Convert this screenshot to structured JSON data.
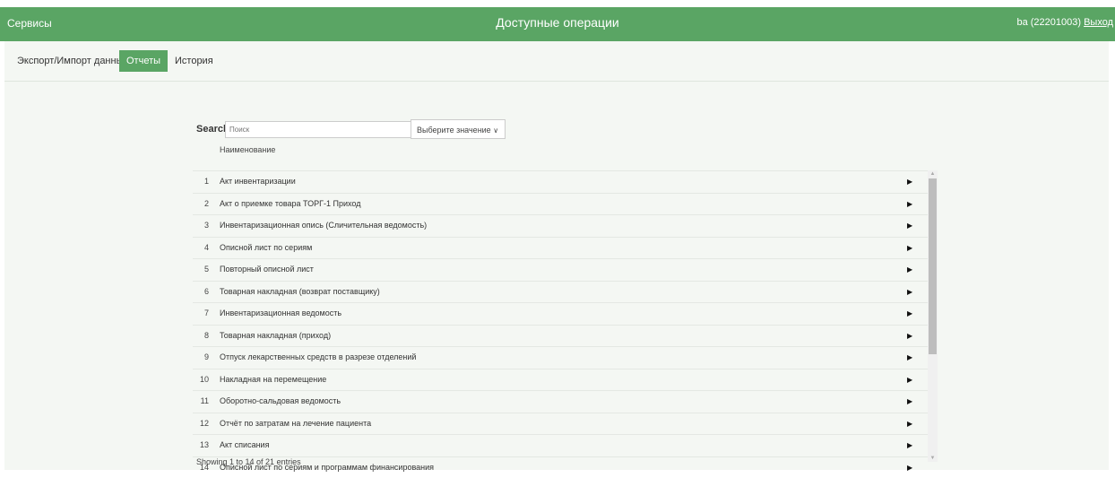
{
  "header": {
    "services_label": "Сервисы",
    "title": "Доступные операции",
    "user": "ba (22201003)",
    "logout_label": "Выход"
  },
  "tabs": [
    {
      "label": "Экспорт/Импорт данных",
      "active": false
    },
    {
      "label": "Отчеты",
      "active": true
    },
    {
      "label": "История",
      "active": false
    }
  ],
  "search": {
    "label": "Search:",
    "placeholder": "Поиск",
    "select_label": "Выберите значение",
    "select_icon": "chevron-down-icon"
  },
  "table": {
    "column_header": "Наименование",
    "row_icon": "play-arrow-icon",
    "rows": [
      {
        "num": "1",
        "name": "Акт инвентаризации"
      },
      {
        "num": "2",
        "name": "Акт о приемке товара ТОРГ-1 Приход"
      },
      {
        "num": "3",
        "name": "Инвентаризационная опись (Сличительная ведомость)"
      },
      {
        "num": "4",
        "name": "Описной лист по сериям"
      },
      {
        "num": "5",
        "name": "Повторный описной лист"
      },
      {
        "num": "6",
        "name": "Товарная накладная (возврат поставщику)"
      },
      {
        "num": "7",
        "name": "Инвентаризационная ведомость"
      },
      {
        "num": "8",
        "name": "Товарная накладная (приход)"
      },
      {
        "num": "9",
        "name": "Отпуск лекарственных средств в разрезе отделений"
      },
      {
        "num": "10",
        "name": "Накладная на перемещение"
      },
      {
        "num": "11",
        "name": "Оборотно-сальдовая ведомость"
      },
      {
        "num": "12",
        "name": "Отчёт по затратам на лечение пациента"
      },
      {
        "num": "13",
        "name": "Акт списания"
      },
      {
        "num": "14",
        "name": "Описной лист по сериям и программам финансирования"
      }
    ]
  },
  "footer": {
    "info": "Showing 1 to 14 of 21 entries"
  },
  "colors": {
    "accent": "#5aa564",
    "background": "#f4f7f3"
  }
}
